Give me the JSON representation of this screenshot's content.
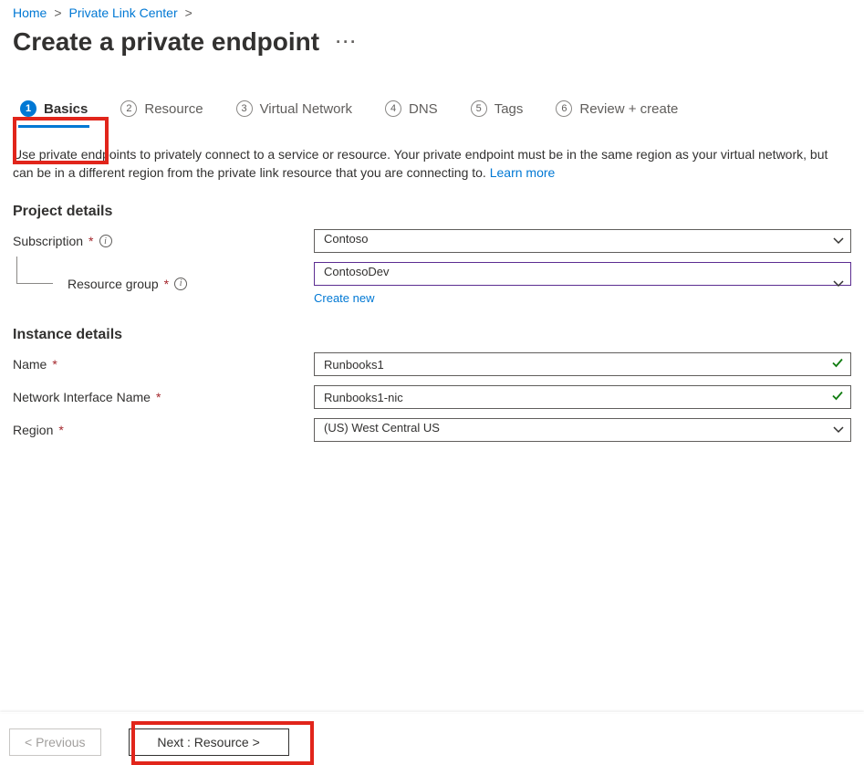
{
  "breadcrumbs": {
    "home": "Home",
    "plc": "Private Link Center"
  },
  "title": "Create a private endpoint",
  "tabs": {
    "basics": {
      "num": "1",
      "label": "Basics"
    },
    "resource": {
      "num": "2",
      "label": "Resource"
    },
    "vnet": {
      "num": "3",
      "label": "Virtual Network"
    },
    "dns": {
      "num": "4",
      "label": "DNS"
    },
    "tags": {
      "num": "5",
      "label": "Tags"
    },
    "review": {
      "num": "6",
      "label": "Review + create"
    }
  },
  "description": {
    "text": "Use private endpoints to privately connect to a service or resource. Your private endpoint must be in the same region as your virtual network, but can be in a different region from the private link resource that you are connecting to.  ",
    "learn_more": "Learn more"
  },
  "sections": {
    "project_details": "Project details",
    "instance_details": "Instance details"
  },
  "fields": {
    "subscription": {
      "label": "Subscription",
      "value": "Contoso"
    },
    "resource_group": {
      "label": "Resource group",
      "value": "ContosoDev",
      "create_new": "Create new"
    },
    "name": {
      "label": "Name",
      "value": "Runbooks1"
    },
    "nic_name": {
      "label": "Network Interface Name",
      "value": "Runbooks1-nic"
    },
    "region": {
      "label": "Region",
      "value": "(US) West Central US"
    }
  },
  "footer": {
    "previous": "< Previous",
    "next": "Next : Resource >"
  }
}
